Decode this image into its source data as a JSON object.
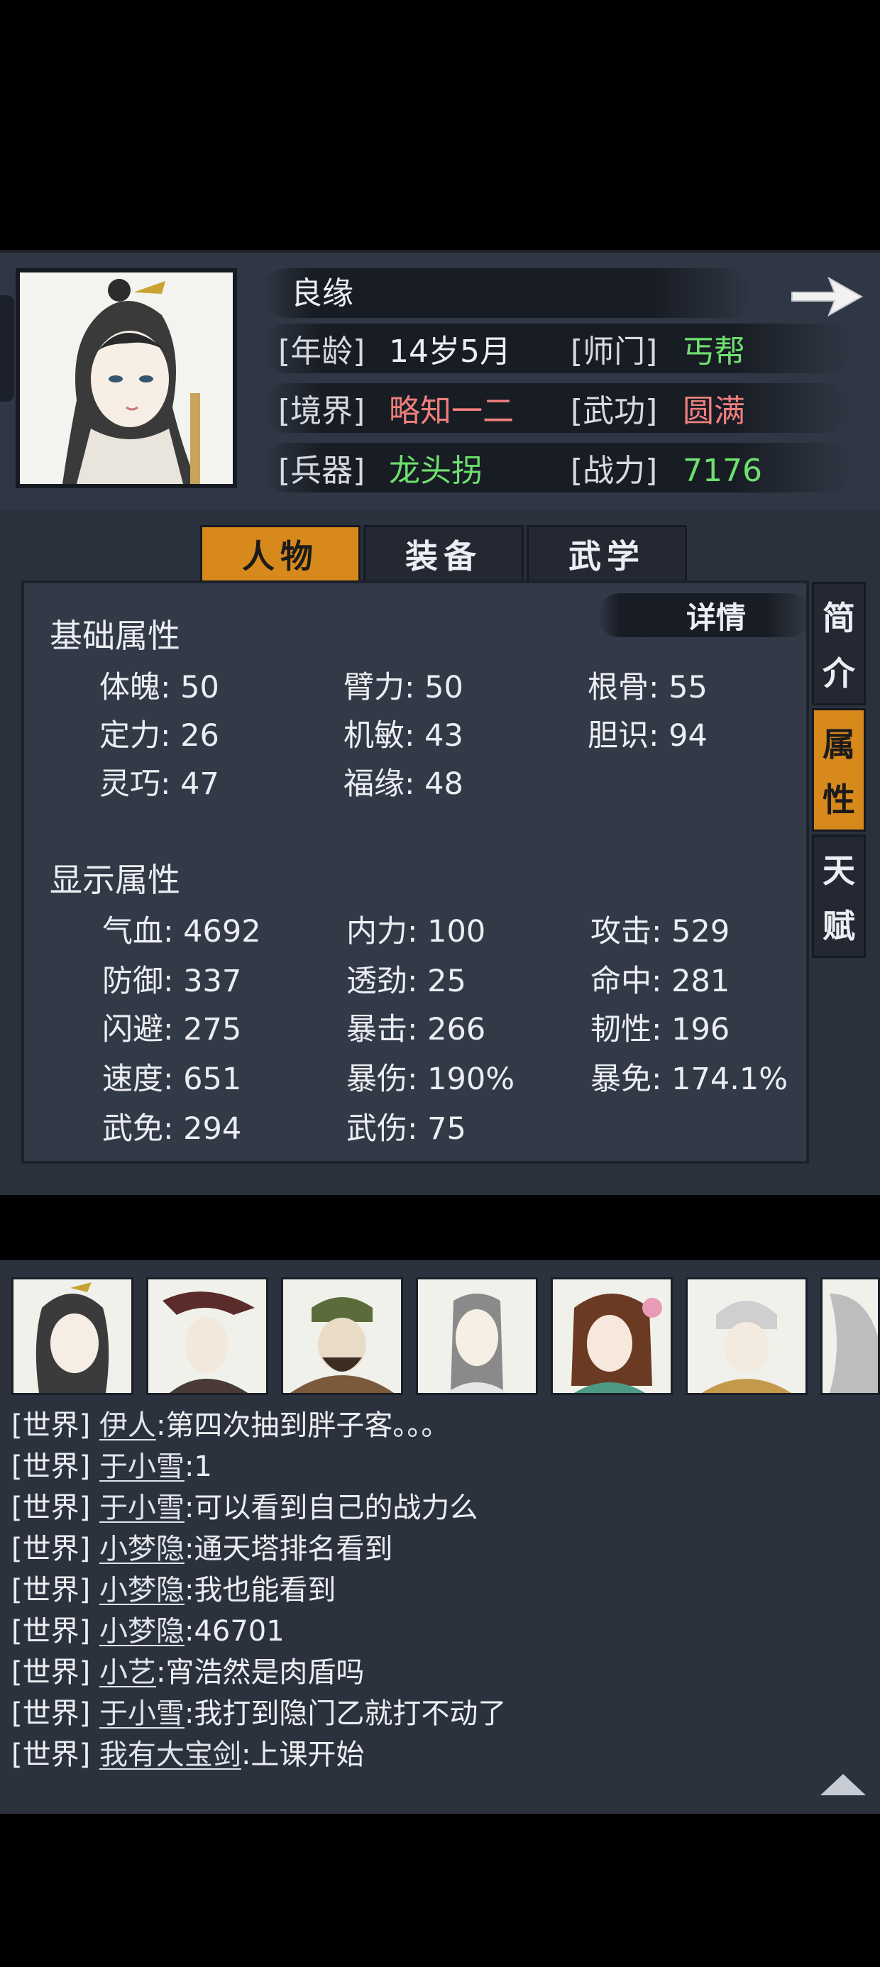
{
  "colors": {
    "header_bg": "#303744",
    "panel_bg": "#2b313c",
    "accent_orange": "#d8891c",
    "value_green": "#6ee06e",
    "value_red": "#ef7f7c"
  },
  "character": {
    "name": "良缘",
    "age_label": "[年龄]",
    "age_value": "14岁5月",
    "sect_label": "[师门]",
    "sect_value": "丐帮",
    "realm_label": "[境界]",
    "realm_value": "略知一二",
    "martial_label": "[武功]",
    "martial_value": "圆满",
    "weapon_label": "[兵器]",
    "weapon_value": "龙头拐",
    "power_label": "[战力]",
    "power_value": "7176",
    "next_icon": "right-arrow-icon"
  },
  "tabs": [
    {
      "label": "人物",
      "active": true
    },
    {
      "label": "装备",
      "active": false
    },
    {
      "label": "武学",
      "active": false
    }
  ],
  "side_tabs": [
    {
      "chars": [
        "简",
        "介"
      ],
      "active": false
    },
    {
      "chars": [
        "属",
        "性"
      ],
      "active": true
    },
    {
      "chars": [
        "天",
        "赋"
      ],
      "active": false
    }
  ],
  "stats": {
    "detail_button": "详情",
    "basic_title": "基础属性",
    "basic": [
      "体魄: 50",
      "臂力: 50",
      "根骨: 55",
      "定力: 26",
      "机敏: 43",
      "胆识: 94",
      "灵巧: 47",
      "福缘: 48"
    ],
    "display_title": "显示属性",
    "display": [
      "气血: 4692",
      "内力: 100",
      "攻击: 529",
      "防御: 337",
      "透劲: 25",
      "命中: 281",
      "闪避: 275",
      "暴击: 266",
      "韧性: 196",
      "速度: 651",
      "暴伤: 190%",
      "暴免: 174.1%",
      "武免: 294",
      "武伤: 75"
    ]
  },
  "chat": {
    "lines": [
      {
        "channel": "[世界]",
        "name": "伊人",
        "message": ":第四次抽到胖子客。。。"
      },
      {
        "channel": "[世界]",
        "name": "于小雪",
        "message": ":1"
      },
      {
        "channel": "[世界]",
        "name": "于小雪",
        "message": ":可以看到自己的战力么"
      },
      {
        "channel": "[世界]",
        "name": "小梦隐",
        "message": ":通天塔排名看到"
      },
      {
        "channel": "[世界]",
        "name": "小梦隐",
        "message": ":我也能看到"
      },
      {
        "channel": "[世界]",
        "name": "小梦隐",
        "message": ":46701"
      },
      {
        "channel": "[世界]",
        "name": "小艺",
        "message": ":宵浩然是肉盾吗"
      },
      {
        "channel": "[世界]",
        "name": "于小雪",
        "message": ":我打到隐门乙就打不动了"
      },
      {
        "channel": "[世界]",
        "name": "我有大宝剑",
        "message": ":上课开始"
      }
    ],
    "scroll_icon": "triangle-up-icon"
  }
}
